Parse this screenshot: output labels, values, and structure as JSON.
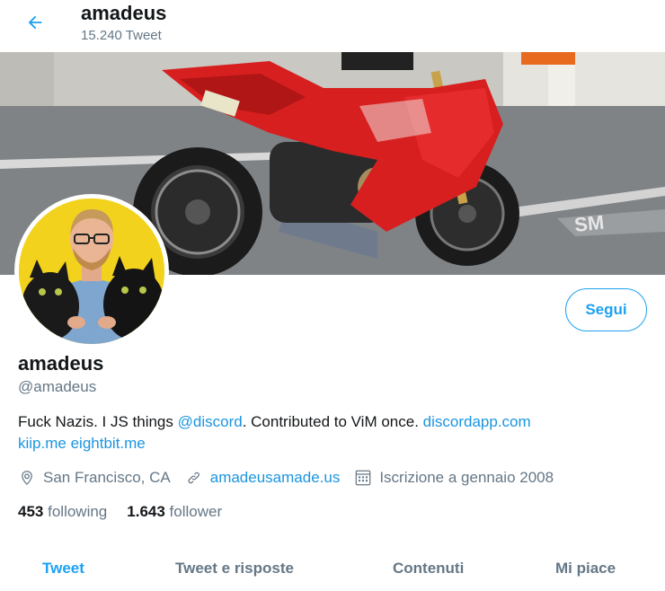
{
  "header": {
    "name": "amadeus",
    "tweet_count": "15.240 Tweet"
  },
  "profile": {
    "display_name": "amadeus",
    "handle": "@amadeus",
    "follow_label": "Segui",
    "bio": {
      "text1": "Fuck Nazis. I JS things ",
      "mention": "@discord",
      "text2": ". Contributed to ViM once. ",
      "link1": "discordapp.com",
      "link2": "kiip.me",
      "link3": "eightbit.me"
    },
    "location": "San Francisco, CA",
    "website": "amadeusamade.us",
    "joined": "Iscrizione a gennaio 2008",
    "following_count": "453",
    "following_label": "following",
    "followers_count": "1.643",
    "followers_label": "follower"
  },
  "tabs": [
    {
      "label": "Tweet",
      "active": true
    },
    {
      "label": "Tweet e risposte",
      "active": false
    },
    {
      "label": "Contenuti",
      "active": false
    },
    {
      "label": "Mi piace",
      "active": false
    }
  ],
  "colors": {
    "accent": "#1da1f2",
    "link": "#1b95e0",
    "secondary_text": "#657786"
  },
  "icons": [
    "back-arrow-icon",
    "location-pin-icon",
    "link-icon",
    "calendar-icon"
  ]
}
